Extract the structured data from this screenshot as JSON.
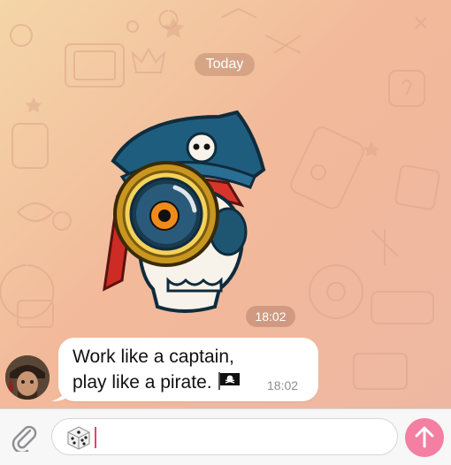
{
  "chat": {
    "date_label": "Today",
    "sticker_time": "18:02",
    "message": {
      "line1": "Work like a captain,",
      "line2": "play like a pirate.",
      "time": "18:02"
    }
  },
  "input": {
    "value": "",
    "placeholder": ""
  },
  "icons": {
    "attach": "paperclip-icon",
    "emoji_button": "dice-icon",
    "send": "arrow-up-icon",
    "flag": "pirate-flag-icon"
  },
  "colors": {
    "send_button": "#f37fa3",
    "caret": "#e8406a",
    "wallpaper_start": "#f4d6a8",
    "wallpaper_end": "#eeb7a3"
  }
}
